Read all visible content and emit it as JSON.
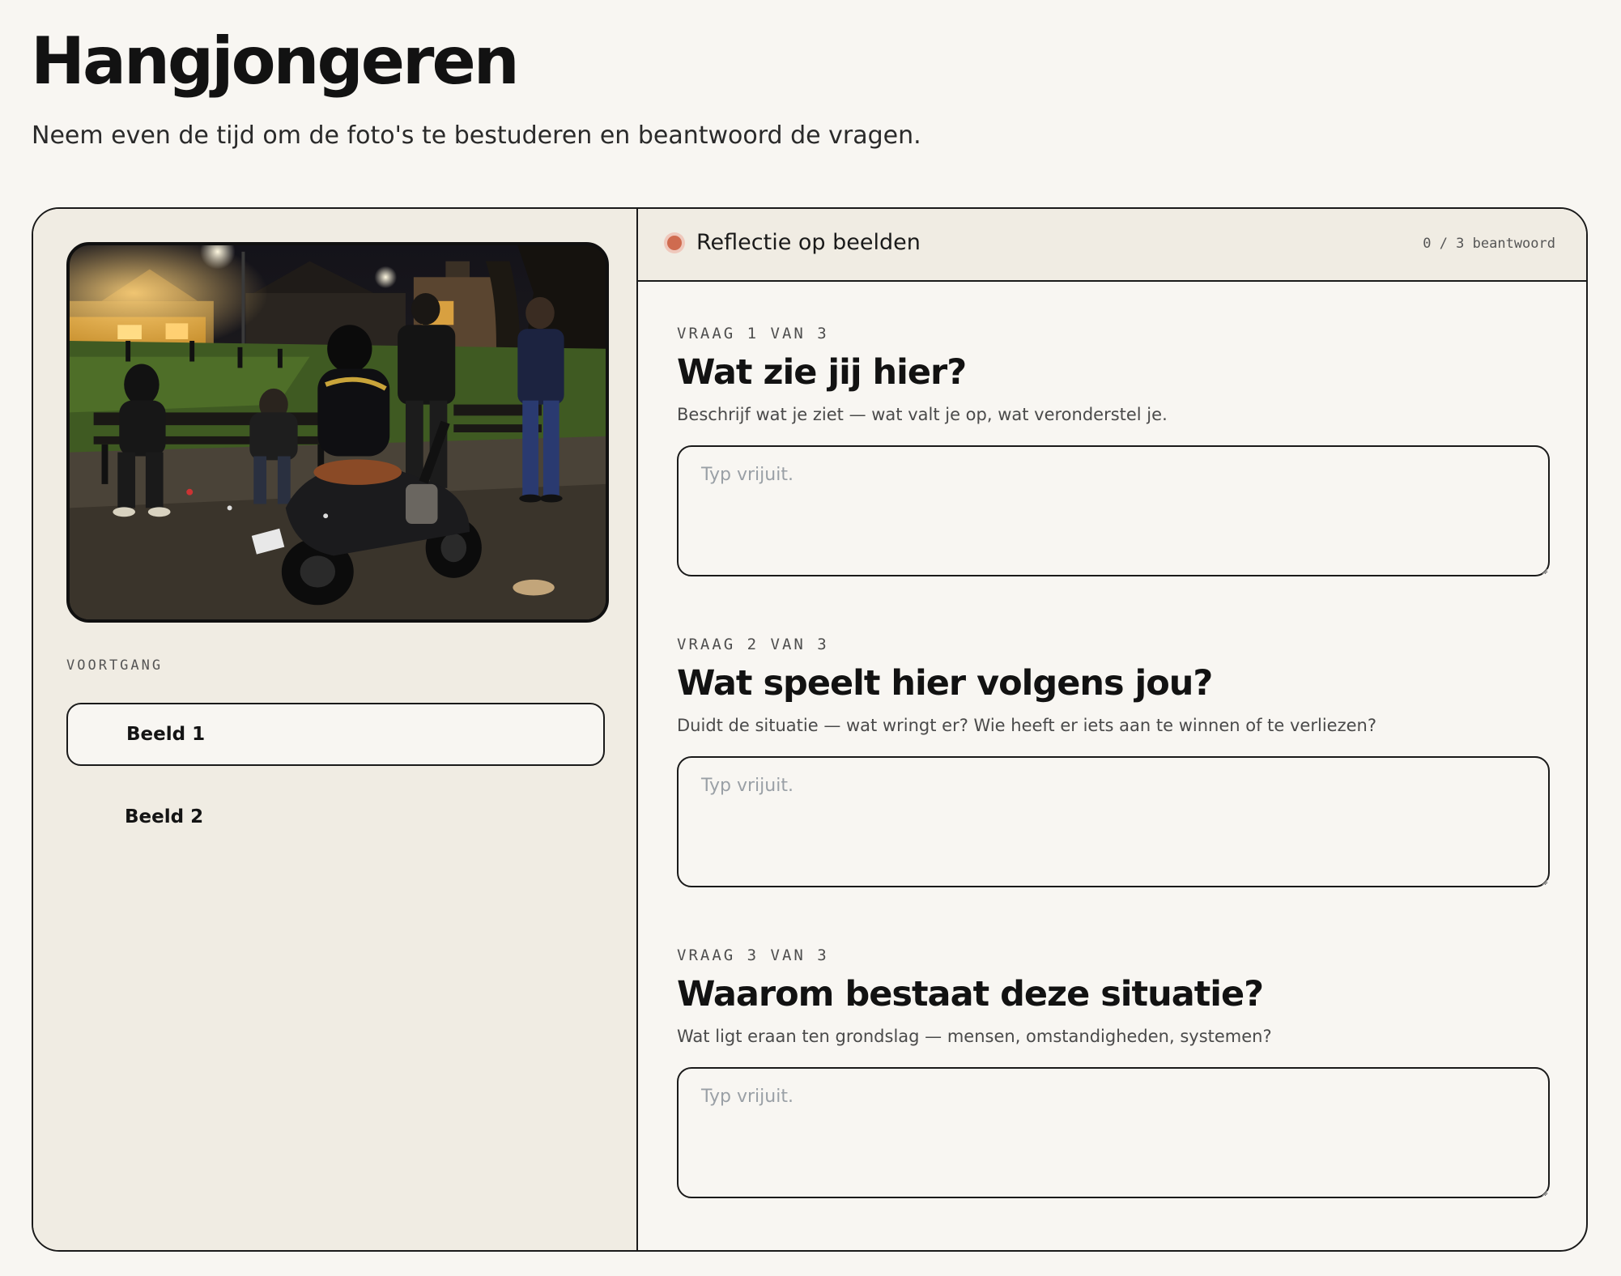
{
  "page": {
    "title": "Hangjongeren",
    "intro": "Neem even de tijd om de foto's te bestuderen en beantwoord de vragen."
  },
  "sidebar": {
    "progress_label": "VOORTGANG",
    "items": [
      {
        "label": "Beeld 1",
        "active": true
      },
      {
        "label": "Beeld 2",
        "active": false
      }
    ]
  },
  "main": {
    "header_title": "Reflectie op beelden",
    "answered_count": "0 / 3 beantwoord",
    "questions": [
      {
        "step": "VRAAG 1 VAN 3",
        "title": "Wat zie jij hier?",
        "help": "Beschrijf wat je ziet — wat valt je op, wat veronderstel je.",
        "placeholder": "Typ vrijuit.",
        "value": ""
      },
      {
        "step": "VRAAG 2 VAN 3",
        "title": "Wat speelt hier volgens jou?",
        "help": "Duidt de situatie — wat wringt er? Wie heeft er iets aan te winnen of te verliezen?",
        "placeholder": "Typ vrijuit.",
        "value": ""
      },
      {
        "step": "VRAAG 3 VAN 3",
        "title": "Waarom bestaat deze situatie?",
        "help": "Wat ligt eraan ten grondslag — mensen, omstandigheden, systemen?",
        "placeholder": "Typ vrijuit.",
        "value": ""
      }
    ]
  },
  "colors": {
    "background": "#f8f6f2",
    "panel": "#f0ece3",
    "accent": "#cf6b4f",
    "border": "#1a1a1a"
  }
}
